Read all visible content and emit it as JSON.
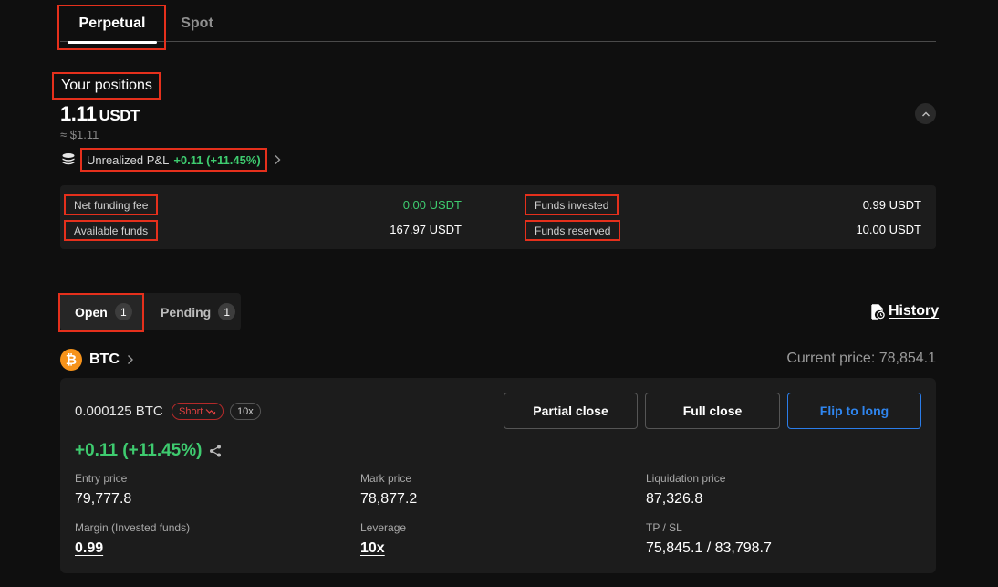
{
  "tabs": {
    "perpetual": "Perpetual",
    "spot": "Spot"
  },
  "positions": {
    "title": "Your positions",
    "balance_value": "1.11",
    "balance_unit": "USDT",
    "approx": "≈ $1.11",
    "pnl_label": "Unrealized P&L",
    "pnl_value": "+0.11 (+11.45%)"
  },
  "stats": {
    "net_funding_fee_label": "Net funding fee",
    "net_funding_fee_value": "0.00 USDT",
    "available_funds_label": "Available funds",
    "available_funds_value": "167.97 USDT",
    "funds_invested_label": "Funds invested",
    "funds_invested_value": "0.99 USDT",
    "funds_reserved_label": "Funds reserved",
    "funds_reserved_value": "10.00 USDT"
  },
  "order_tabs": {
    "open_label": "Open",
    "open_count": "1",
    "pending_label": "Pending",
    "pending_count": "1",
    "history_label": "History"
  },
  "asset": {
    "symbol_glyph": "₿",
    "name": "BTC",
    "current_price": "Current price: 78,854.1"
  },
  "position": {
    "size": "0.000125 BTC",
    "side": "Short",
    "leverage_tag": "10x",
    "partial_close": "Partial close",
    "full_close": "Full close",
    "flip": "Flip to long",
    "pnl": "+0.11 (+11.45%)",
    "entry_price_label": "Entry price",
    "entry_price": "79,777.8",
    "mark_price_label": "Mark price",
    "mark_price": "78,877.2",
    "liq_price_label": "Liquidation price",
    "liq_price": "87,326.8",
    "margin_label": "Margin (Invested funds)",
    "margin": "0.99",
    "leverage_label": "Leverage",
    "leverage": "10x",
    "tpsl_label": "TP / SL",
    "tpsl": "75,845.1 / 83,798.7"
  },
  "colors": {
    "accent_red": "#e5301c",
    "profit_green": "#3ecb6f",
    "flip_blue": "#2f86f0",
    "short_red": "#e04040",
    "btc_orange": "#f7931a"
  },
  "icons": [
    "coins-stack-icon",
    "chevron-right-icon",
    "chevron-up-icon",
    "history-doc-icon",
    "bitcoin-icon",
    "share-icon",
    "trend-down-icon"
  ]
}
